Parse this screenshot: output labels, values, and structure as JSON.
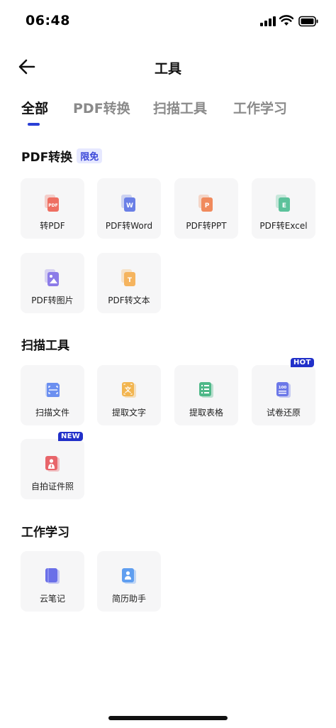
{
  "status": {
    "time": "06:48"
  },
  "nav": {
    "title": "工具"
  },
  "tabs": [
    {
      "label": "全部",
      "active": true
    },
    {
      "label": "PDF转换",
      "active": false
    },
    {
      "label": "扫描工具",
      "active": false
    },
    {
      "label": "工作学习",
      "active": false
    }
  ],
  "sections": {
    "pdf": {
      "title": "PDF转换",
      "badge": "限免",
      "items": [
        {
          "label": "转PDF",
          "icon": "pdf-doc-icon",
          "letter": "PDF",
          "color": "#ee6f62"
        },
        {
          "label": "PDF转Word",
          "icon": "word-doc-icon",
          "letter": "W",
          "color": "#6a7fe6"
        },
        {
          "label": "PDF转PPT",
          "icon": "ppt-doc-icon",
          "letter": "P",
          "color": "#f08a5d"
        },
        {
          "label": "PDF转Excel",
          "icon": "excel-doc-icon",
          "letter": "E",
          "color": "#5cc29b"
        },
        {
          "label": "PDF转图片",
          "icon": "image-doc-icon",
          "letter": "",
          "color": "#8c7ce8"
        },
        {
          "label": "PDF转文本",
          "icon": "text-doc-icon",
          "letter": "T",
          "color": "#f5b45f"
        }
      ]
    },
    "scan": {
      "title": "扫描工具",
      "items": [
        {
          "label": "扫描文件",
          "icon": "scan-file-icon",
          "color": "#6b8ff0"
        },
        {
          "label": "提取文字",
          "icon": "extract-text-icon",
          "color": "#f2b550",
          "glyph": "文"
        },
        {
          "label": "提取表格",
          "icon": "extract-table-icon",
          "color": "#4fb889"
        },
        {
          "label": "试卷还原",
          "icon": "exam-restore-icon",
          "color": "#6c78e8",
          "glyph": "100",
          "tag": "HOT"
        },
        {
          "label": "自拍证件照",
          "icon": "id-photo-icon",
          "color": "#e8656a",
          "tag": "NEW"
        }
      ]
    },
    "work": {
      "title": "工作学习",
      "items": [
        {
          "label": "云笔记",
          "icon": "cloud-note-icon",
          "color": "#6a6fe8"
        },
        {
          "label": "简历助手",
          "icon": "resume-icon",
          "color": "#5f9ef0"
        }
      ]
    }
  }
}
